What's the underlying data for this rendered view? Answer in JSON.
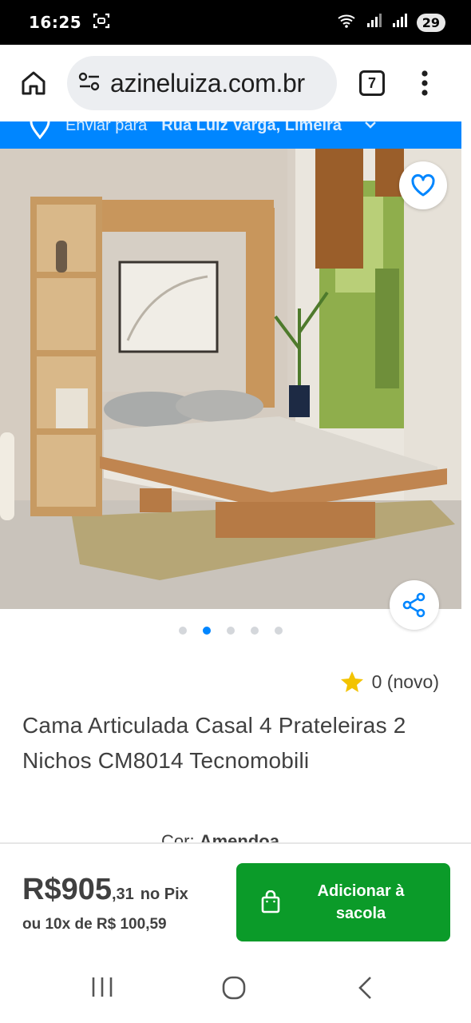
{
  "status": {
    "time": "16:25",
    "battery": "29"
  },
  "browser": {
    "url": "azineluiza.com.br",
    "tab_count": "7"
  },
  "delivery": {
    "text_prefix": "Enviar para",
    "address": "Rua Luiz Varga, Limeira"
  },
  "gallery": {
    "image_count": 5,
    "active_index": 1
  },
  "product": {
    "rating_text": "0 (novo)",
    "title": "Cama Articulada Casal 4 Prateleiras 2 Nichos CM8014 Tecnomobili",
    "color_label": "Cor:",
    "color_value": "Amendoa"
  },
  "purchase": {
    "price_main": "R$905",
    "price_cents": ",31",
    "price_method": "no Pix",
    "installments": "ou 10x de R$ 100,59",
    "cta_label": "Adicionar à sacola"
  },
  "colors": {
    "brand_blue": "#0086ff",
    "cta_green": "#0b9b29",
    "star_yellow": "#f3c300",
    "text_gray": "#404040"
  }
}
